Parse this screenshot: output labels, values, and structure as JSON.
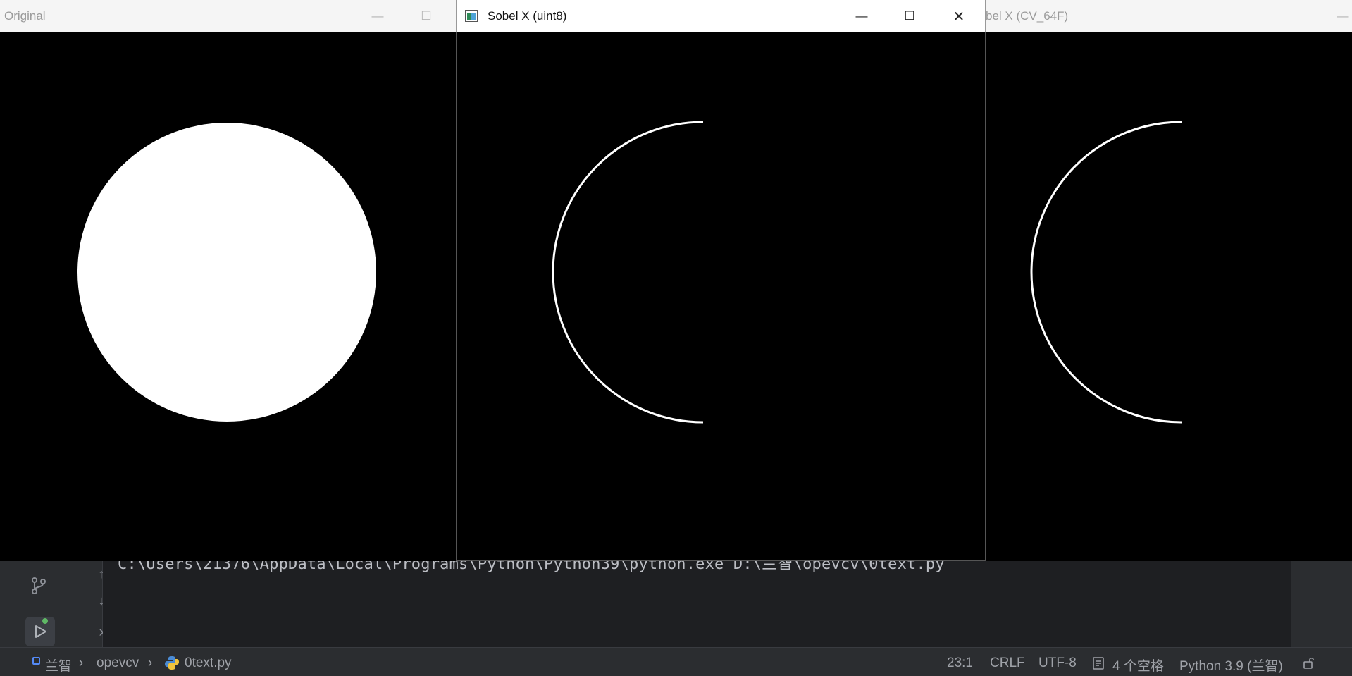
{
  "windows": {
    "original": {
      "title": "Original"
    },
    "sobel_uint8": {
      "title": "Sobel X (uint8)"
    },
    "sobel_64f": {
      "title": "bel X (CV_64F)"
    }
  },
  "window_controls": {
    "minimize": "—",
    "maximize": "☐",
    "close": "✕"
  },
  "console": {
    "command": "C:\\Users\\21376\\AppData\\Local\\Programs\\Python\\Python39\\python.exe D:\\兰智\\opevcv\\0text.py"
  },
  "statusbar": {
    "breadcrumb": [
      "兰智",
      "opevcv",
      "0text.py"
    ],
    "position": "23:1",
    "line_ending": "CRLF",
    "encoding": "UTF-8",
    "indent": "4 个空格",
    "interpreter": "Python 3.9 (兰智)"
  },
  "colors": {
    "window_bg": "#000000",
    "shape": "#ffffff",
    "ide_bg": "#1e1f22",
    "statusbar_bg": "#2b2d30"
  }
}
